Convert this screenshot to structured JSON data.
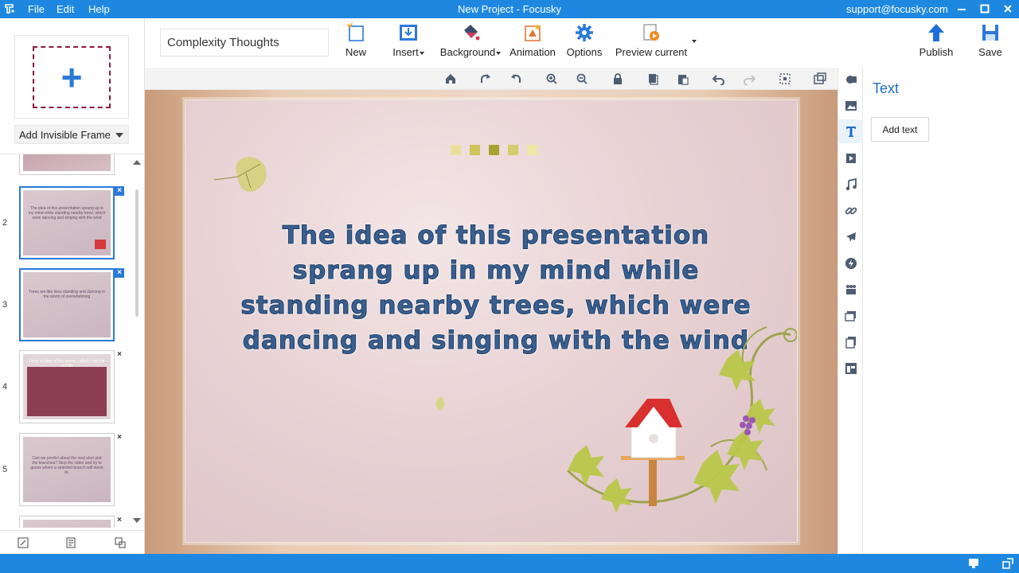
{
  "window": {
    "title": "New Project - Focusky",
    "email": "support@focusky.com",
    "menu": [
      "File",
      "Edit",
      "Help"
    ]
  },
  "left_panel": {
    "add_frame_label": "Add Invisible Frame",
    "thumbnails": [
      {
        "number": "2",
        "text": "The idea of this presentation sprang up in my mind while standing nearby trees, which were dancing and singing with the wind"
      },
      {
        "number": "3",
        "text": "Trees are like lives standing and dancing in the storm of overwhelming"
      },
      {
        "number": "4",
        "text": "I took a video of the scene... alled t oad the ouTub"
      },
      {
        "number": "5",
        "text": "Can we predict about the next shot and the branches? Stop the video and try to guess where a selected branch will move to."
      }
    ]
  },
  "toolbar": {
    "project_name": "Complexity Thoughts",
    "new": "New",
    "insert": "Insert",
    "background": "Background",
    "animation": "Animation",
    "options": "Options",
    "preview": "Preview current",
    "publish": "Publish",
    "save": "Save"
  },
  "slide": {
    "text": "The idea of this presentation sprang up in my mind while standing nearby trees, which were dancing and singing with the wind",
    "dot_colors": [
      "#ecdf9c",
      "#cfc65a",
      "#a9a32e",
      "#d5cc6a",
      "#f0e6a8"
    ]
  },
  "right_panel": {
    "title": "Text",
    "add_text": "Add text"
  },
  "colors": {
    "accent": "#1e88e0",
    "selection": "#2a7ad8"
  }
}
